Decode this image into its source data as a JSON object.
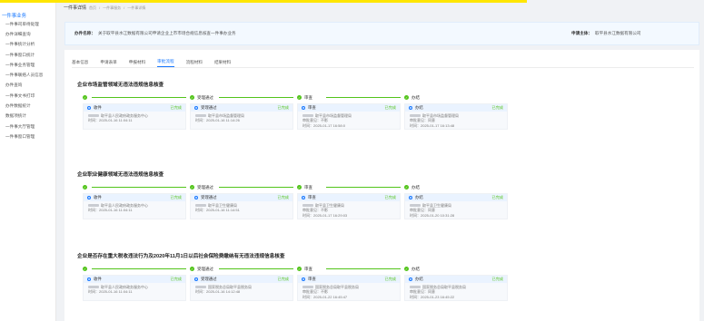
{
  "sidebar": {
    "title": "一件事业务",
    "items": [
      "一件事司单待处理",
      "办件详细查询",
      "一件事统计分析",
      "一件事窗口统计",
      "一件事业务管理",
      "一件事联络人员信息",
      "办件查询",
      "一件事文书打印",
      "办件数据统计",
      "数据项统计",
      "一件事大厅管理",
      "一件事窗口管理"
    ]
  },
  "breadcrumb": {
    "main": "一件事详情",
    "sub1": "首页",
    "sub2": "一件事服务",
    "sub3": "一件事详情"
  },
  "info": {
    "name_label": "办件名称：",
    "name_value": "关于取平县水江数据有限公司申请企业上市市场合规信息核查一件事办业务",
    "applicant_label": "申请主体：",
    "applicant_value": "取平县水江数据有限公司"
  },
  "tabs": [
    "基本信息",
    "申请表单",
    "申报材料",
    "审批流程",
    "流程材料",
    "结果材料"
  ],
  "active_tab": 3,
  "stage_names": [
    "",
    "受理通过",
    "审查",
    "办结"
  ],
  "sections": [
    {
      "title": "企业市场监管领域无违法违规信息核查",
      "cards": [
        {
          "node": "收件",
          "status": "已完成",
          "who": "取平县人民政府政务服务中心",
          "extra": "",
          "time": "时间：2025-01-16 11:04:11"
        },
        {
          "node": "受理通过",
          "status": "已完成",
          "who": "取平县市场监督管理局",
          "extra": "",
          "time": "时间：2025-01-16 11:14:26"
        },
        {
          "node": "审查",
          "status": "已完成",
          "who": "取平县市场监督管理局",
          "extra": "审批意见：不影",
          "time": "时间：2025-01-17 16:58:0"
        },
        {
          "node": "办结",
          "status": "已完成",
          "who": "取平县市场监督管理局",
          "extra": "审批意见：同意",
          "time": "时间：2025-01-17 16:13:48"
        }
      ]
    },
    {
      "title": "企业职业健康领域无违法违规信息核查",
      "cards": [
        {
          "node": "收件",
          "status": "已完成",
          "who": "取平县人民政府政务服务中心",
          "extra": "",
          "time": "时间：2025-01-16 11:04:11"
        },
        {
          "node": "受理通过",
          "status": "已完成",
          "who": "取平县卫生健康局",
          "extra": "",
          "time": "时间：2025-01-16 11:14:51"
        },
        {
          "node": "审查",
          "status": "已完成",
          "who": "取平县卫生健康局",
          "extra": "审批意见：不影",
          "time": "时间：2025-01-17 16:29:03"
        },
        {
          "node": "办结",
          "status": "已完成",
          "who": "取平县卫生健康局",
          "extra": "审批意见：同意",
          "time": "时间：2025-01-20 10:31:28"
        }
      ]
    },
    {
      "title": "企业是否存在重大税收违法行为及2020年11月1日以后社会保险费缴纳有无违法违规信息核查",
      "cards": [
        {
          "node": "收件",
          "status": "已完成",
          "who": "取平县人民政府政务服务中心",
          "extra": "",
          "time": "时间：2025-01-16 11:04:11"
        },
        {
          "node": "受理通过",
          "status": "已完成",
          "who": "国家税务总局取平县税务局",
          "extra": "",
          "time": "时间：2025-01-16 14:12:48"
        },
        {
          "node": "审查",
          "status": "已完成",
          "who": "国家税务总局取平县税务局",
          "extra": "审批意见：不影",
          "time": "时间：2025-01-22 16:45:47"
        },
        {
          "node": "办结",
          "status": "已完成",
          "who": "国家税务总局取平县税务局",
          "extra": "审批意见：同意",
          "time": "时间：2025-01-23 16:45:22"
        }
      ]
    }
  ]
}
